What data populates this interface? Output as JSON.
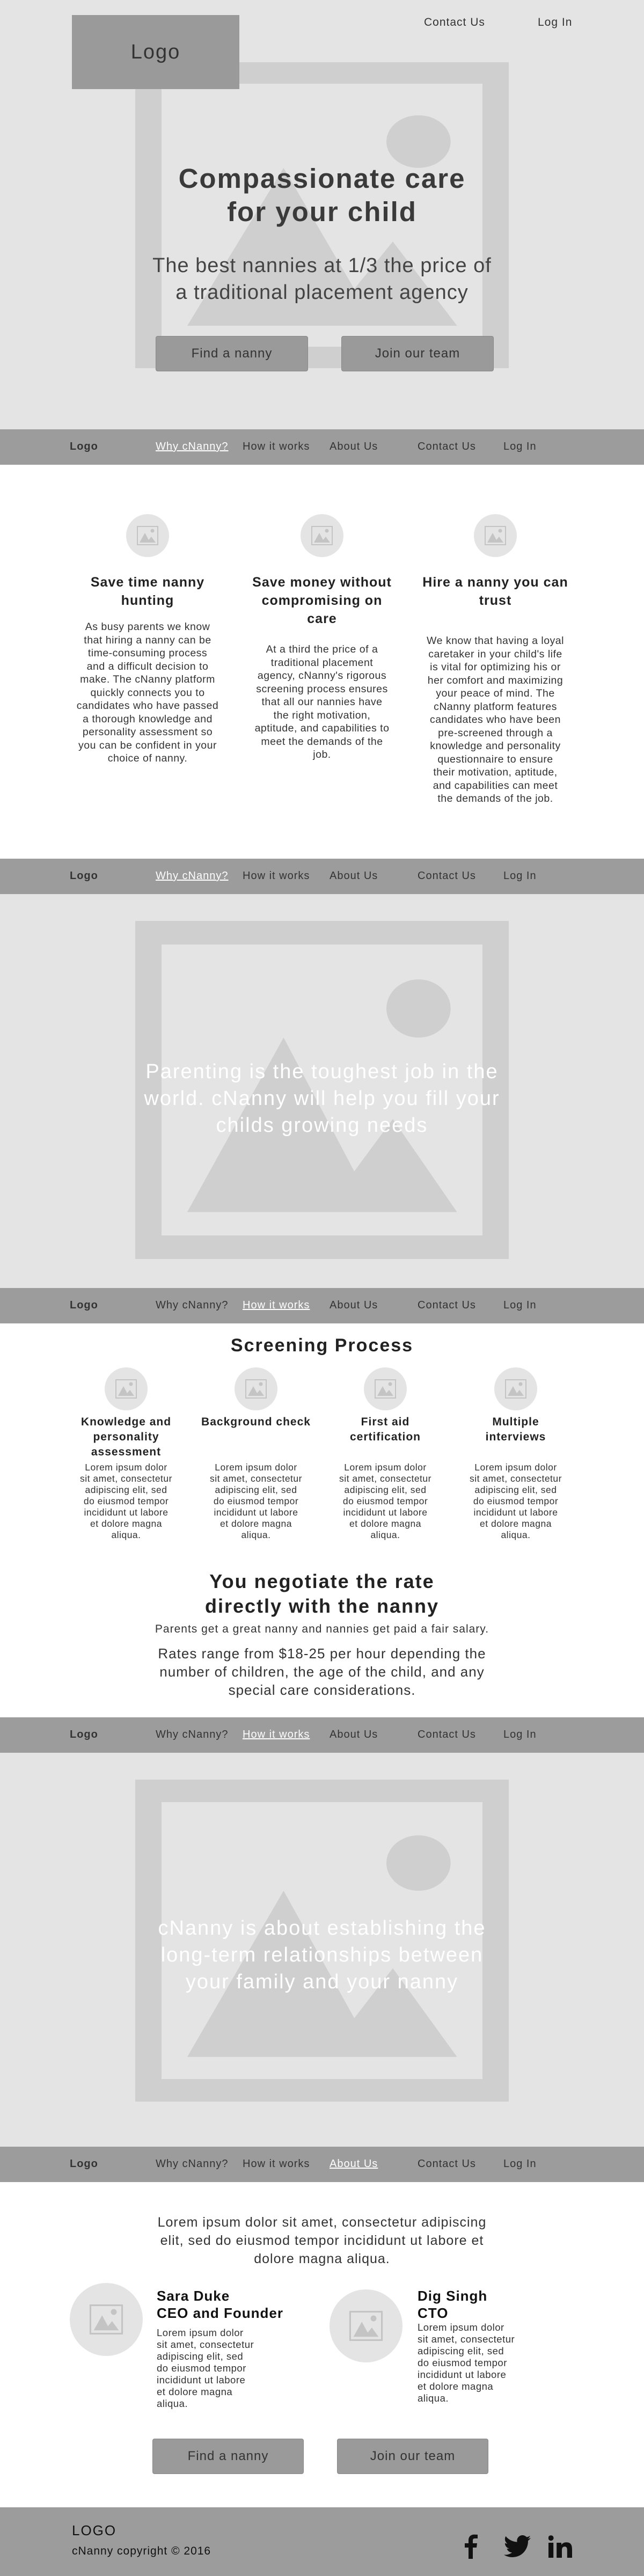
{
  "top_nav": {
    "logo": "Logo",
    "contact": "Contact Us",
    "login": "Log In"
  },
  "hero": {
    "title_line1": "Compassionate care",
    "title_line2": "for your child",
    "subtitle_line1": "The best nannies at 1/3 the price of",
    "subtitle_line2": "a traditional placement agency",
    "button_find": "Find a nanny",
    "button_join": "Join our team"
  },
  "nav": {
    "logo": "Logo",
    "why": "Why cNanny?",
    "how": "How it works",
    "about": "About Us",
    "contact": "Contact Us",
    "login": "Log In"
  },
  "benefits": [
    {
      "title": [
        "Save time nanny",
        "hunting"
      ],
      "text": [
        "As busy parents we know",
        "that hiring a nanny can be",
        "time-consuming process",
        "and a difficult decision to",
        "make. The cNanny platform",
        "quickly connects you to",
        "candidates who have passed",
        "a thorough knowledge and",
        "personality assessment so",
        "you can be confident in your",
        "choice of nanny."
      ]
    },
    {
      "title": [
        "Save money without",
        "compromising on",
        "care"
      ],
      "text": [
        "At a third the price of a",
        "traditional placement",
        "agency, cNanny's rigorous",
        "screening process ensures",
        "that all our nannies have",
        "the right motivation,",
        "aptitude, and capabilities to",
        "meet the demands of the",
        "job."
      ]
    },
    {
      "title": [
        "Hire a nanny you can",
        "trust"
      ],
      "text": [
        "We know that having a loyal",
        "caretaker in your child's life",
        "is vital for optimizing his or",
        "her comfort and maximizing",
        "your peace of mind. The",
        "cNanny platform features",
        "candidates who have been",
        "pre-screened through a",
        "knowledge and personality",
        "questionnaire to ensure",
        "their motivation, aptitude,",
        "and capabilities can meet",
        "the demands of the job."
      ]
    }
  ],
  "banner1": {
    "lines": [
      "Parenting is the toughest job in the",
      "world. cNanny will help you fill your",
      "childs growing needs"
    ]
  },
  "screening": {
    "heading": "Screening Process",
    "steps": [
      {
        "title": [
          "Knowledge and",
          "personality",
          "assessment"
        ]
      },
      {
        "title": [
          "Background check"
        ]
      },
      {
        "title": [
          "First aid",
          "certification"
        ]
      },
      {
        "title": [
          "Multiple",
          "interviews"
        ]
      }
    ],
    "lorem": [
      "Lorem ipsum dolor",
      "sit amet, consectetur",
      "adipiscing elit, sed",
      "do eiusmod tempor",
      "incididunt ut labore",
      "et dolore magna",
      "aliqua."
    ]
  },
  "negotiate": {
    "heading_line1": "You negotiate the rate",
    "heading_line2": "directly with the nanny",
    "line1": "Parents get a great nanny and nannies get paid a fair salary.",
    "rates": [
      "Rates range from $18-25 per hour depending the",
      "number of children, the age of the child, and any",
      "special care considerations."
    ]
  },
  "banner2": {
    "lines": [
      "cNanny is about establishing the",
      "long-term relationships between",
      "your family and your nanny"
    ]
  },
  "about": {
    "intro": [
      "Lorem ipsum dolor sit amet, consectetur adipiscing",
      "elit, sed do eiusmod tempor incididunt ut labore et",
      "dolore magna aliqua."
    ],
    "people": [
      {
        "name": "Sara Duke",
        "role": "CEO and Founder",
        "text": [
          "Lorem ipsum dolor",
          "sit amet, consectetur",
          "adipiscing elit, sed",
          "do eiusmod tempor",
          "incididunt ut labore",
          "et dolore magna",
          "aliqua."
        ]
      },
      {
        "name": "Dig Singh",
        "role": "CTO",
        "text": [
          "Lorem ipsum dolor",
          "sit amet, consectetur",
          "adipiscing elit, sed",
          "do eiusmod tempor",
          "incididunt ut labore",
          "et dolore magna",
          "aliqua."
        ]
      }
    ],
    "button_find": "Find a nanny",
    "button_join": "Join our team"
  },
  "footer": {
    "logo": "LOGO",
    "copyright": "cNanny copyright © 2016"
  },
  "icons": [
    "facebook-icon",
    "twitter-icon",
    "linkedin-icon",
    "image-placeholder-icon"
  ]
}
